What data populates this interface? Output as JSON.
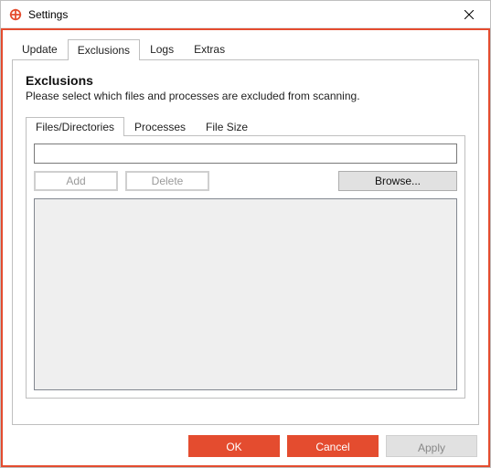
{
  "window": {
    "title": "Settings"
  },
  "tabs": {
    "update": "Update",
    "exclusions": "Exclusions",
    "logs": "Logs",
    "extras": "Extras",
    "active": "exclusions"
  },
  "exclusions": {
    "heading": "Exclusions",
    "description": "Please select which files and processes are excluded from scanning.",
    "inner_tabs": {
      "files": "Files/Directories",
      "processes": "Processes",
      "file_size": "File Size",
      "active": "files"
    },
    "path_value": "",
    "path_placeholder": "",
    "buttons": {
      "add": "Add",
      "delete": "Delete",
      "browse": "Browse..."
    },
    "list_items": []
  },
  "footer": {
    "ok": "OK",
    "cancel": "Cancel",
    "apply": "Apply"
  },
  "colors": {
    "accent": "#e44c2f"
  }
}
